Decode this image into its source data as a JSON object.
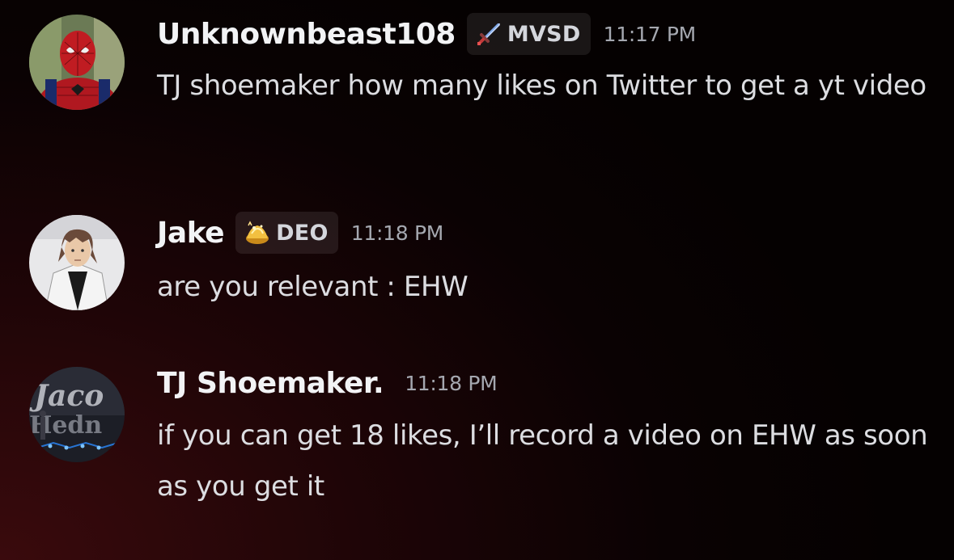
{
  "messages": [
    {
      "username": "Unknownbeast108",
      "tag": "MVSD",
      "tag_icon": "sword-icon",
      "time": "11:17 PM",
      "text": "TJ shoemaker how many likes on Twitter to get a yt video",
      "avatar": "spiderman-avatar"
    },
    {
      "username": "Jake",
      "tag": "DEO",
      "tag_icon": "gold-pile-icon",
      "time": "11:18 PM",
      "text": "are you relevant : EHW",
      "avatar": "anime-character-avatar"
    },
    {
      "username": "TJ Shoemaker.",
      "tag": "",
      "time": "11:18 PM",
      "text": "if you can get 18 likes, I’ll record a video on EHW as soon as you get it",
      "avatar": "stage-logo-avatar"
    }
  ],
  "colors": {
    "username": "#f2f3f5",
    "message_text": "#dcdde1",
    "timestamp": "#a5a8b0",
    "tag_bg": "#2a2526",
    "background_accent": "#3a0a0d"
  }
}
